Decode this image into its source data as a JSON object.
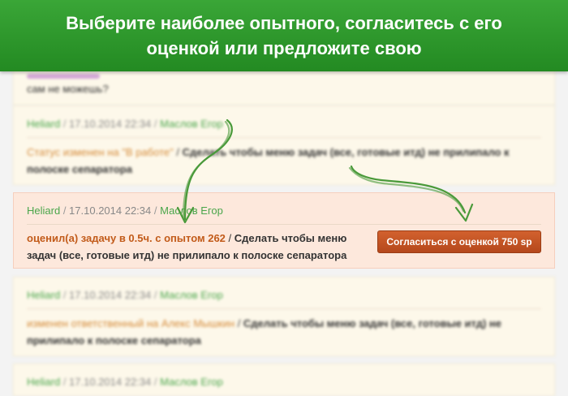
{
  "banner": {
    "line1": "Выберите наиболее опытного, согласитесь с его",
    "line2": "оценкой или предложите свою"
  },
  "top_comment": {
    "text": "сам не можешь?"
  },
  "comments": [
    {
      "author": "Heliard",
      "date": "17.10.2014 22:34",
      "responsible": "Маслов Егор",
      "status": "Статус изменен на \"В работе\"",
      "task": "Сделать чтобы меню задач (все, готовые итд) не прилипало к",
      "task2": "полоске сепаратора"
    },
    {
      "author": "Heliard",
      "date": "17.10.2014 22:34",
      "responsible": "Маслов Егор",
      "estimate": "оценил(а) задачу в 0.5ч. с опытом 262",
      "task": "Сделать чтобы меню",
      "task2": "задач (все, готовые итд) не прилипало к полоске сепаратора",
      "button": "Согласиться с оценкой 750 sp"
    },
    {
      "author": "Heliard",
      "date": "17.10.2014 22:34",
      "responsible": "Маслов Егор",
      "status": "изменен ответственный на Алекс Мышкин",
      "task": "Сделать чтобы меню задач (все, готовые итд) не",
      "task2": "прилипало к полоске сепаратора"
    },
    {
      "author": "Heliard",
      "date": "17.10.2014 22:34",
      "responsible": "Маслов Егор"
    }
  ],
  "colors": {
    "banner": "#2f9a2d",
    "user_link": "#4aa64b",
    "status": "#c25b1a",
    "button": "#c4562a",
    "highlight_card": "#fde8dc"
  }
}
